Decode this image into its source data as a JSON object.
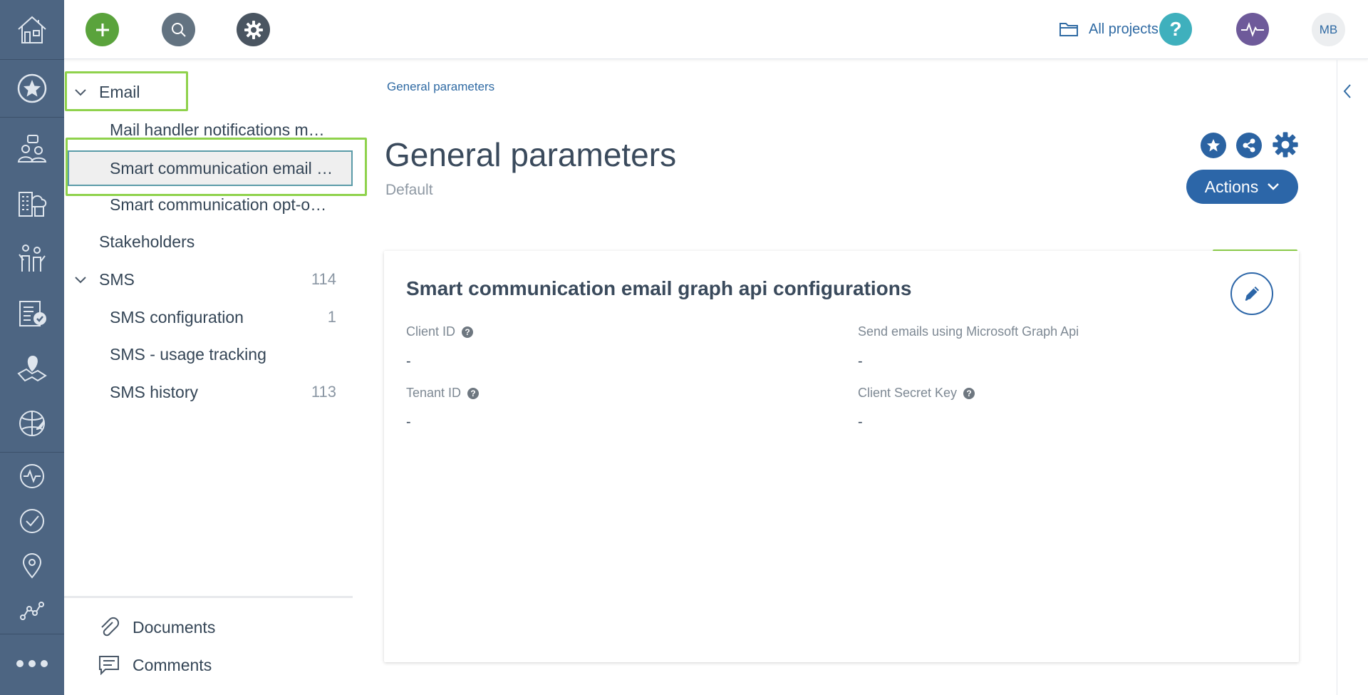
{
  "topbar": {
    "all_projects_label": "All projects",
    "help_symbol": "?",
    "avatar_initials": "MB"
  },
  "tree": {
    "email_label": "Email",
    "mail_handler_label": "Mail handler notifications m…",
    "smart_email_label": "Smart communication email …",
    "smart_optout_label": "Smart communication opt-o…",
    "stakeholders_label": "Stakeholders",
    "sms_label": "SMS",
    "sms_count": "114",
    "sms_config_label": "SMS configuration",
    "sms_config_count": "1",
    "sms_usage_label": "SMS - usage tracking",
    "sms_history_label": "SMS history",
    "sms_history_count": "113"
  },
  "bottom": {
    "documents_label": "Documents",
    "comments_label": "Comments"
  },
  "main": {
    "breadcrumb": "General parameters",
    "title": "General parameters",
    "subtitle": "Default",
    "actions_label": "Actions"
  },
  "card": {
    "title": "Smart communication email graph api configurations",
    "client_id_label": "Client ID",
    "client_id_value": "-",
    "send_emails_label": "Send emails using Microsoft Graph Api",
    "send_emails_value": "-",
    "tenant_id_label": "Tenant ID",
    "tenant_id_value": "-",
    "client_secret_label": "Client Secret Key",
    "client_secret_value": "-",
    "help_symbol": "?"
  },
  "colors": {
    "rail": "#4d6582",
    "accent": "#2c66a8",
    "add_green": "#5aa33c",
    "highlight": "#8fd24c"
  }
}
